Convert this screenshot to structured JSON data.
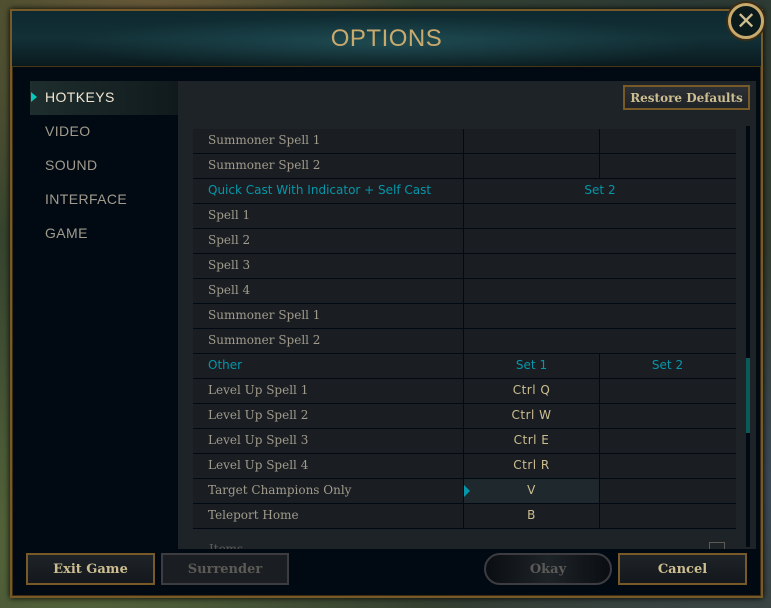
{
  "dialog": {
    "title": "OPTIONS",
    "close_glyph": "✕"
  },
  "sidebar": {
    "items": [
      {
        "label": "HOTKEYS",
        "active": true
      },
      {
        "label": "VIDEO",
        "active": false
      },
      {
        "label": "SOUND",
        "active": false
      },
      {
        "label": "INTERFACE",
        "active": false
      },
      {
        "label": "GAME",
        "active": false
      }
    ]
  },
  "toolbar": {
    "restore_label": "Restore Defaults"
  },
  "rows": [
    {
      "type": "row",
      "name": "Summoner Spell 1",
      "set1": "",
      "set2": ""
    },
    {
      "type": "row",
      "name": "Summoner Spell 2",
      "set1": "",
      "set2": ""
    },
    {
      "type": "section",
      "name": "Quick Cast With Indicator + Self Cast",
      "set_label": "Set 2"
    },
    {
      "type": "row",
      "name": "Spell 1",
      "single": ""
    },
    {
      "type": "row",
      "name": "Spell 2",
      "single": ""
    },
    {
      "type": "row",
      "name": "Spell 3",
      "single": ""
    },
    {
      "type": "row",
      "name": "Spell 4",
      "single": ""
    },
    {
      "type": "row",
      "name": "Summoner Spell 1",
      "single": ""
    },
    {
      "type": "row",
      "name": "Summoner Spell 2",
      "single": ""
    },
    {
      "type": "section2",
      "name": "Other",
      "set1": "Set 1",
      "set2": "Set 2"
    },
    {
      "type": "row",
      "name": "Level Up Spell 1",
      "set1": "Ctrl  Q",
      "set2": ""
    },
    {
      "type": "row",
      "name": "Level Up Spell 2",
      "set1": "Ctrl  W",
      "set2": ""
    },
    {
      "type": "row",
      "name": "Level Up Spell 3",
      "set1": "Ctrl  E",
      "set2": ""
    },
    {
      "type": "row",
      "name": "Level Up Spell 4",
      "set1": "Ctrl  R",
      "set2": ""
    },
    {
      "type": "row",
      "name": "Target Champions Only",
      "set1": "V",
      "set2": "",
      "selected": true
    },
    {
      "type": "row",
      "name": "Teleport Home",
      "set1": "B",
      "set2": ""
    }
  ],
  "next_section_label": "Items",
  "footer": {
    "exit_label": "Exit Game",
    "surrender_label": "Surrender",
    "okay_label": "Okay",
    "cancel_label": "Cancel"
  },
  "colors": {
    "gold": "#c8aa6e",
    "teal": "#0596aa",
    "panel": "#1e2328"
  }
}
